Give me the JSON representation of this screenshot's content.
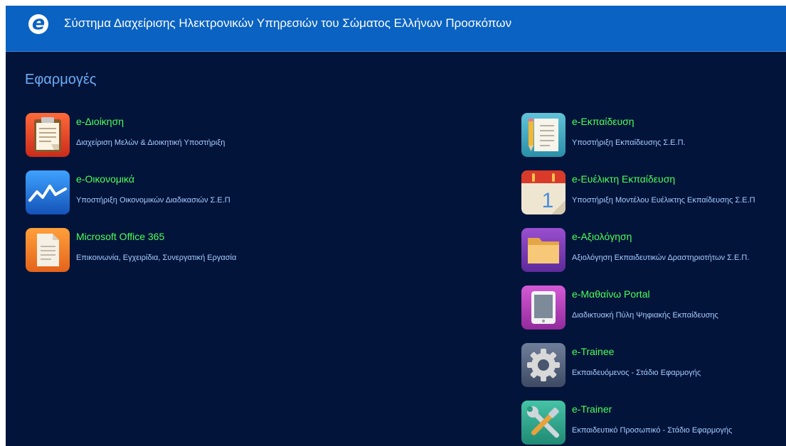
{
  "header": {
    "logo_letter": "e",
    "title": "Σύστημα Διαχείρισης Ηλεκτρονικών Υπηρεσιών του Σώματος Ελλήνων Προσκόπων"
  },
  "colors": {
    "header_background": "#0a62c2",
    "page_background": "#02143a",
    "section_title": "#6eaef5",
    "app_name": "#4dff5a",
    "app_description": "#a8ccff"
  },
  "section": {
    "title": "Εφαρμογές"
  },
  "apps_left": [
    {
      "name": "e-Διοίκηση",
      "description": "Διαχείριση Μελών & Διοικητική Υποστήριξη",
      "icon": "clipboard-icon"
    },
    {
      "name": "e-Οικονομικά",
      "description": "Υποστήριξη Οικονομικών Διαδικασιών Σ.Ε.Π",
      "icon": "stocks-chart-icon"
    },
    {
      "name": "Microsoft Office 365",
      "description": "Επικοινωνία, Εγχειρίδια, Συνεργατική Εργασία",
      "icon": "document-icon"
    }
  ],
  "apps_right": [
    {
      "name": "e-Εκπαίδευση",
      "description": "Υποστήριξη Εκπαίδευσης Σ.Ε.Π.",
      "icon": "notepad-pencil-icon"
    },
    {
      "name": "e-Ευέλικτη Εκπαίδευση",
      "description": "Υποστήριξη Μοντέλου Ευέλικτης Εκπαίδευσης Σ.Ε.Π",
      "icon": "calendar-icon",
      "calendar_day": "1"
    },
    {
      "name": "e-Αξιολόγηση",
      "description": "Αξιολόγηση Εκπαιδευτικών Δραστηριοτήτων Σ.Ε.Π.",
      "icon": "folder-icon"
    },
    {
      "name": "e-Μαθαίνω Portal",
      "description": "Διαδικτυακή Πύλη Ψηφιακής Εκπαίδευσης",
      "icon": "tablet-icon"
    },
    {
      "name": "e-Trainee",
      "description": "Εκπαιδευόμενος - Στάδιο Εφαρμογής",
      "icon": "gear-icon"
    },
    {
      "name": "e-Trainer",
      "description": "Εκπαιδευτικό Προσωπικό - Στάδιο Εφαρμογής",
      "icon": "tools-icon"
    }
  ]
}
